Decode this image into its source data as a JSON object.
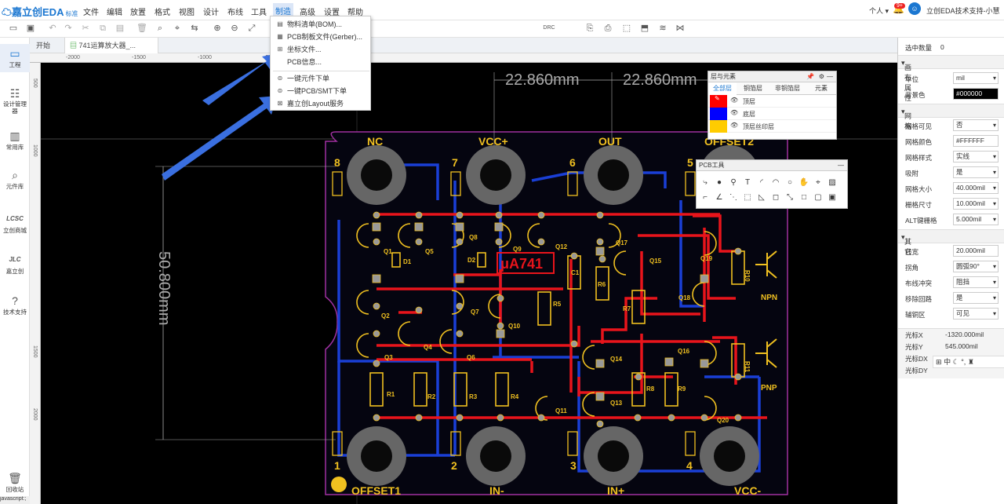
{
  "app": {
    "logo": "嘉立创EDA",
    "edition": "标准"
  },
  "menu": [
    {
      "label": "文件"
    },
    {
      "label": "编辑"
    },
    {
      "label": "放置"
    },
    {
      "label": "格式"
    },
    {
      "label": "视图"
    },
    {
      "label": "设计"
    },
    {
      "label": "布线"
    },
    {
      "label": "工具"
    },
    {
      "label": "制造"
    },
    {
      "label": "高级"
    },
    {
      "label": "设置"
    },
    {
      "label": "帮助"
    }
  ],
  "user": {
    "personal": "个人",
    "notifications": "9+",
    "account": "立创EDA技术支持-小慧"
  },
  "toolbar": {
    "drc": "DRC"
  },
  "sidebar": [
    {
      "label": "工程",
      "icon": "folder-icon"
    },
    {
      "label": "设计管理器",
      "icon": "tree-icon"
    },
    {
      "label": "常用库",
      "icon": "chip-icon"
    },
    {
      "label": "元件库",
      "icon": "search-icon"
    },
    {
      "label": "立创商城",
      "icon": "lcsc-icon"
    },
    {
      "label": "嘉立创",
      "icon": "jlc-icon"
    },
    {
      "label": "技术支持",
      "icon": "help-icon"
    },
    {
      "label": "回收站",
      "icon": "trash-icon"
    }
  ],
  "status_text": "javascript:;",
  "tabs": [
    {
      "label": "开始"
    },
    {
      "label": "741运算放大器_..."
    }
  ],
  "rulers": {
    "top": [
      "-2000",
      "-1500",
      "-1000",
      "-500"
    ],
    "left": [
      "500",
      "1000",
      "1500",
      "2000"
    ]
  },
  "manufacture_menu": {
    "items": [
      {
        "label": "物料清单(BOM)..."
      },
      {
        "label": "PCB制板文件(Gerber)..."
      },
      {
        "label": "坐标文件..."
      },
      {
        "label": "PCB信息..."
      },
      {
        "label": "一键元件下单"
      },
      {
        "label": "一键PCB/SMT下单"
      },
      {
        "label": "嘉立创Layout服务"
      }
    ]
  },
  "layers_panel": {
    "title": "层与元素",
    "tabs": [
      {
        "label": "全部层"
      },
      {
        "label": "铜箔层"
      },
      {
        "label": "非铜箔层"
      },
      {
        "label": "元素"
      }
    ],
    "layers": [
      {
        "name": "顶层",
        "color": "#ff0000"
      },
      {
        "name": "底层",
        "color": "#0000ff"
      },
      {
        "name": "顶层丝印层",
        "color": "#ffcc00"
      }
    ]
  },
  "pcb_tools": {
    "title": "PCB工具"
  },
  "pcb": {
    "dimension_h1": "22.860mm",
    "dimension_h2": "22.860mm",
    "dimension_v": "50.800mm",
    "chip_label": "μA741",
    "pin_labels": {
      "top": [
        "NC",
        "VCC+",
        "OUT",
        "OFFSET2"
      ],
      "bottom": [
        "OFFSET1",
        "IN-",
        "IN+",
        "VCC-"
      ],
      "top_nums": [
        "8",
        "7",
        "6",
        "5"
      ],
      "bottom_nums": [
        "1",
        "2",
        "3",
        "4"
      ]
    },
    "components": [
      "Q1",
      "Q2",
      "Q3",
      "Q4",
      "Q5",
      "Q6",
      "Q7",
      "Q8",
      "Q9",
      "Q10",
      "Q11",
      "Q12",
      "Q13",
      "Q14",
      "Q15",
      "Q16",
      "Q17",
      "Q18",
      "Q19",
      "Q20",
      "R1",
      "R2",
      "R3",
      "R4",
      "R5",
      "R6",
      "R7",
      "R8",
      "R9",
      "R10",
      "R11",
      "D1",
      "D2",
      "C1"
    ],
    "legend_npn": "NPN",
    "legend_pnp": "PNP"
  },
  "right_panel": {
    "selected_count_label": "选中数量",
    "selected_count": "0",
    "sections": {
      "canvas": "画布属性",
      "grid": "网格",
      "other": "其它"
    },
    "props": {
      "unit": {
        "label": "单位",
        "value": "mil"
      },
      "bg": {
        "label": "背景色",
        "value": "#000000"
      },
      "grid_visible": {
        "label": "网格可见",
        "value": "否"
      },
      "grid_color": {
        "label": "网格颜色",
        "value": "#FFFFFF"
      },
      "grid_style": {
        "label": "网格样式",
        "value": "实线"
      },
      "snap": {
        "label": "吸附",
        "value": "是"
      },
      "grid_size": {
        "label": "网格大小",
        "value": "40.000mil"
      },
      "fence_size": {
        "label": "栅格尺寸",
        "value": "10.000mil"
      },
      "alt_grid": {
        "label": "ALT键栅格",
        "value": "5.000mil"
      },
      "line_width": {
        "label": "线宽",
        "value": "20.000mil"
      },
      "corner": {
        "label": "拐角",
        "value": "圆弧90°"
      },
      "route_conflict": {
        "label": "布线冲突",
        "value": "阻挡"
      },
      "remove_loop": {
        "label": "移除回路",
        "value": "是"
      },
      "aux": {
        "label": "辅铜区",
        "value": "可见"
      }
    },
    "cursor": {
      "x_label": "光标X",
      "x": "-1320.000mil",
      "y_label": "光标Y",
      "y": "545.000mil",
      "dx_label": "光标DX",
      "dy_label": "光标DY"
    }
  }
}
